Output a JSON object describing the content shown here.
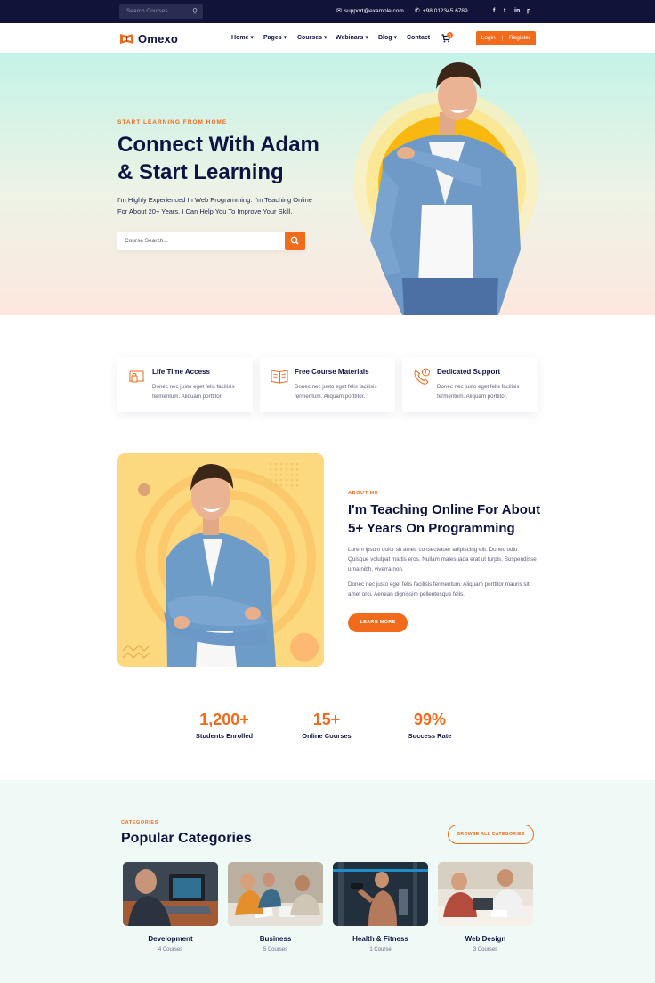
{
  "topbar": {
    "search_placeholder": "Search Courses",
    "email": "support@example.com",
    "phone": "+98 012345 6789",
    "social": [
      "f",
      "t",
      "in",
      "p"
    ]
  },
  "nav": {
    "logo_text": "Omexo",
    "menu": [
      "Home",
      "Pages",
      "Courses",
      "Webinars",
      "Blog",
      "Contact"
    ],
    "cart_count": "0",
    "login": "Login",
    "register": "Register"
  },
  "hero": {
    "subtitle": "START LEARNING FROM HOME",
    "title_line1": "Connect With Adam",
    "title_line2": "& Start Learning",
    "desc_line1": "I'm Highly Experienced In Web Programming. I'm Teaching Online",
    "desc_line2": "For About 20+ Years. I Can Help You To Improve Your Skill.",
    "search_placeholder": "Course Search..."
  },
  "features": [
    {
      "title": "Life Time Access",
      "text": "Donec nec justo eget felis facilisis fermentum. Aliquam porttitor.",
      "icon": "lock-laptop-icon"
    },
    {
      "title": "Free Course Materials",
      "text": "Donec nec justo eget felis facilisis fermentum. Aliquam porttitor.",
      "icon": "book-icon"
    },
    {
      "title": "Dedicated Support",
      "text": "Donec nec justo eget felis facilisis fermentum. Aliquam porttitor.",
      "icon": "phone-support-icon"
    }
  ],
  "about": {
    "subtitle": "ABOUT ME",
    "title": "I'm Teaching Online For About 5+ Years On Programming",
    "p1": "Lorem ipsum dolor sit amet, consectetuer adipiscing elit. Donec odio. Quisque volutpat mattis eros. Nullam malesuada erat ut turpis. Suspendisse urna nibh, viverra non.",
    "p2": "Donec nec justo eget felis facilisis fermentum. Aliquam porttitor mauris sit amet orci. Aenean dignissim pellentesque felis.",
    "button": "LEARN MORE"
  },
  "stats": [
    {
      "value": "1,200+",
      "label": "Students Enrolled"
    },
    {
      "value": "15+",
      "label": "Online Courses"
    },
    {
      "value": "99%",
      "label": "Success Rate"
    }
  ],
  "categories": {
    "subtitle": "CATEGORIES",
    "title": "Popular Categories",
    "browse": "BROWSE ALL CATEGORIES",
    "items": [
      {
        "name": "Development",
        "count": "4 Courses"
      },
      {
        "name": "Business",
        "count": "5 Courses"
      },
      {
        "name": "Health & Fitness",
        "count": "1 Course"
      },
      {
        "name": "Web Design",
        "count": "3 Courses"
      }
    ]
  },
  "colors": {
    "accent": "#f26a1b",
    "navy": "#0f1342",
    "topbar": "#111338"
  }
}
